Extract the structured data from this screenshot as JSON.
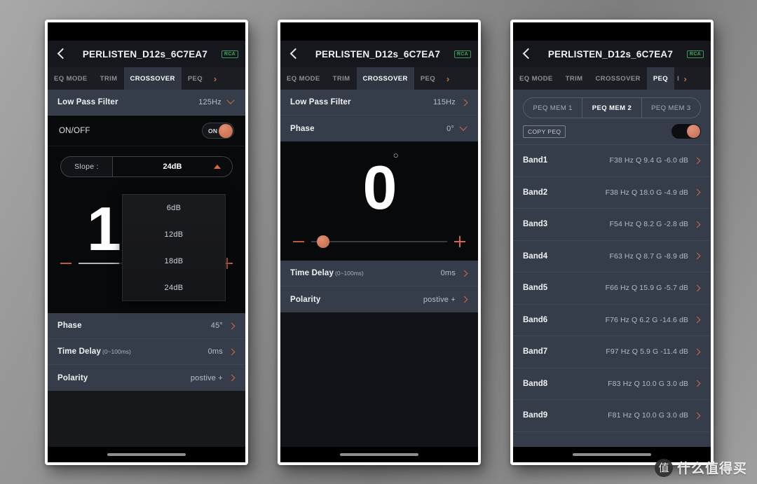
{
  "watermark": {
    "logo_glyph": "值",
    "text": "什么值得买"
  },
  "app": {
    "device_title": "PERLISTEN_D12s_6C7EA7",
    "input_badge": "RCA",
    "tabs": [
      "EQ MODE",
      "TRIM",
      "CROSSOVER",
      "PEQ"
    ],
    "tab_overflow_partial": "I",
    "tab_arrow_glyph": "›"
  },
  "phone1": {
    "active_tab": "CROSSOVER",
    "low_pass_filter": {
      "label": "Low Pass Filter",
      "value": "125Hz"
    },
    "onoff": {
      "label": "ON/OFF",
      "state": "ON"
    },
    "slope": {
      "label": "Slope :",
      "value": "24dB"
    },
    "slope_options": [
      "6dB",
      "12dB",
      "18dB",
      "24dB"
    ],
    "big_value": "1",
    "rows": [
      {
        "label": "Phase",
        "sub": "",
        "value": "45°"
      },
      {
        "label": "Time Delay",
        "sub": "(0~100ms)",
        "value": "0ms"
      },
      {
        "label": "Polarity",
        "sub": "",
        "value": "postive +"
      }
    ]
  },
  "phone2": {
    "active_tab": "CROSSOVER",
    "low_pass_filter": {
      "label": "Low Pass Filter",
      "value": "115Hz"
    },
    "phase": {
      "label": "Phase",
      "value": "0°"
    },
    "big_value": "0",
    "degree_mark": "○",
    "rows": [
      {
        "label": "Time Delay",
        "sub": "(0~100ms)",
        "value": "0ms"
      },
      {
        "label": "Polarity",
        "sub": "",
        "value": "postive +"
      }
    ]
  },
  "phone3": {
    "active_tab": "PEQ",
    "peq_memories": [
      "PEQ MEM 1",
      "PEQ MEM 2",
      "PEQ MEM 3"
    ],
    "active_memory": "PEQ MEM 2",
    "copy_button": "COPY PEQ",
    "bands": [
      {
        "label": "Band1",
        "value": "F38 Hz Q 9.4 G -6.0 dB"
      },
      {
        "label": "Band2",
        "value": "F38 Hz Q 18.0 G -4.9 dB"
      },
      {
        "label": "Band3",
        "value": "F54 Hz Q 8.2 G -2.8 dB"
      },
      {
        "label": "Band4",
        "value": "F63 Hz Q 8.7 G -8.9 dB"
      },
      {
        "label": "Band5",
        "value": "F66 Hz Q 15.9 G -5.7 dB"
      },
      {
        "label": "Band6",
        "value": "F76 Hz Q 6.2 G -14.6 dB"
      },
      {
        "label": "Band7",
        "value": "F97 Hz Q 5.9 G -11.4 dB"
      },
      {
        "label": "Band8",
        "value": "F83 Hz Q 10.0 G 3.0 dB"
      },
      {
        "label": "Band9",
        "value": "F81 Hz Q 10.0 G 3.0 dB"
      }
    ]
  },
  "colors": {
    "accent": "#cf6a42",
    "row_bg": "#353d4b",
    "panel_bg": "#08090b",
    "badge_green": "#3ea85c"
  }
}
